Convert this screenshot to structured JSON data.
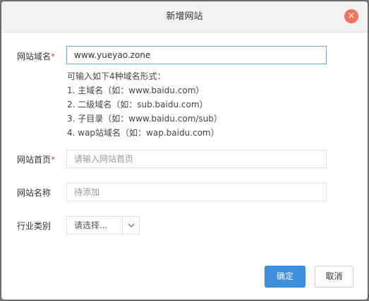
{
  "dialog": {
    "title": "新增网站",
    "close_icon": "×"
  },
  "colors": {
    "close": "#f2705f",
    "primary": "#3e8fdd",
    "required": "#e0483a",
    "focus_border": "#6fa8dc"
  },
  "form": {
    "domain": {
      "label": "网站域名",
      "required_mark": "*",
      "value": "www.yueyao.zone"
    },
    "hints": [
      "可输入如下4种域名形式：",
      "1. 主域名（如：www.baidu.com）",
      "2. 二级域名（如：sub.baidu.com）",
      "3. 子目录（如：www.baidu.com/sub）",
      "4. wap站域名（如：wap.baidu.com）"
    ],
    "homepage": {
      "label": "网站首页",
      "required_mark": "*",
      "placeholder": "请输入网站首页"
    },
    "site_name": {
      "label": "网站名称",
      "placeholder": "待添加"
    },
    "industry": {
      "label": "行业类别",
      "selected": "请选择...",
      "arrow_icon": "chevron-down-icon"
    }
  },
  "buttons": {
    "ok": "确定",
    "cancel": "取消"
  }
}
